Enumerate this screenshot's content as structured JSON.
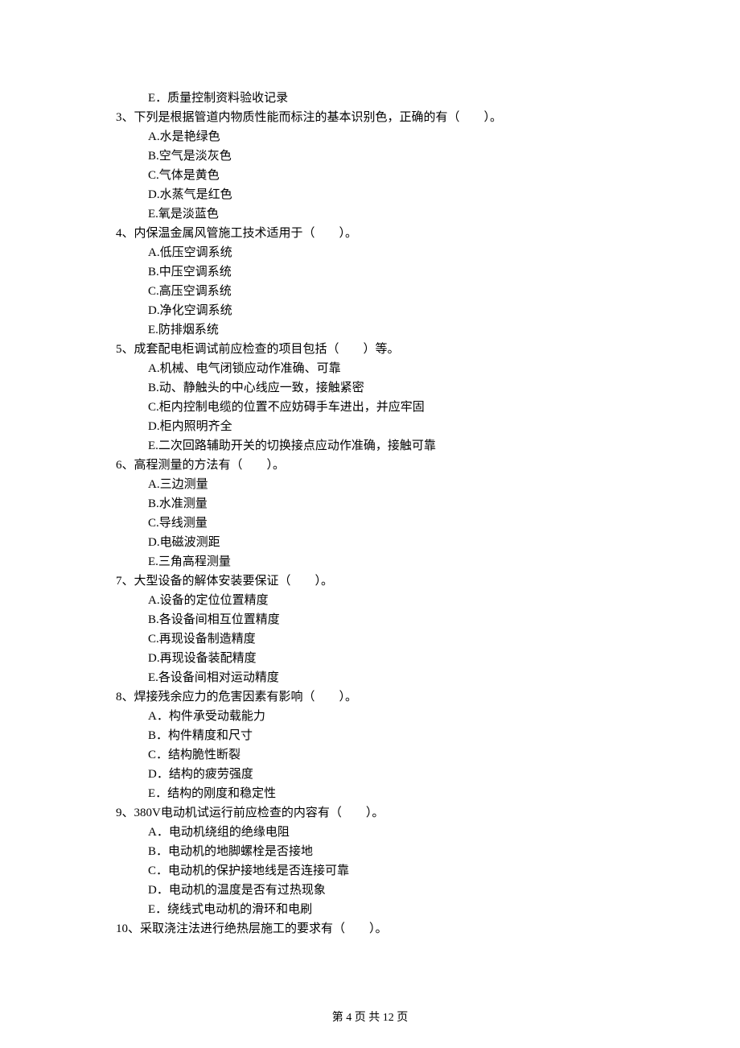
{
  "orphan_option_E": "E．质量控制资料验收记录",
  "questions": [
    {
      "stem": "3、下列是根据管道内物质性能而标注的基本识别色，正确的有（　　）。",
      "options": [
        "A.水是艳绿色",
        "B.空气是淡灰色",
        "C.气体是黄色",
        "D.水蒸气是红色",
        "E.氧是淡蓝色"
      ]
    },
    {
      "stem": "4、内保温金属风管施工技术适用于（　　）。",
      "options": [
        "A.低压空调系统",
        "B.中压空调系统",
        "C.高压空调系统",
        "D.净化空调系统",
        "E.防排烟系统"
      ]
    },
    {
      "stem": "5、成套配电柜调试前应检查的项目包括（　　）等。",
      "options": [
        "A.机械、电气闭锁应动作准确、可靠",
        "B.动、静触头的中心线应一致，接触紧密",
        "C.柜内控制电缆的位置不应妨碍手车进出，并应牢固",
        "D.柜内照明齐全",
        "E.二次回路辅助开关的切换接点应动作准确，接触可靠"
      ]
    },
    {
      "stem": "6、高程测量的方法有（　　）。",
      "options": [
        "A.三边测量",
        "B.水准测量",
        "C.导线测量",
        "D.电磁波测距",
        "E.三角高程测量"
      ]
    },
    {
      "stem": "7、大型设备的解体安装要保证（　　）。",
      "options": [
        "A.设备的定位位置精度",
        "B.各设备间相互位置精度",
        "C.再现设备制造精度",
        "D.再现设备装配精度",
        "E.各设备间相对运动精度"
      ]
    },
    {
      "stem": "8、焊接残余应力的危害因素有影响（　　）。",
      "options": [
        "A．构件承受动载能力",
        "B．构件精度和尺寸",
        "C．结构脆性断裂",
        "D．结构的疲劳强度",
        "E．结构的刚度和稳定性"
      ]
    },
    {
      "stem": "9、380V电动机试运行前应检查的内容有（　　）。",
      "options": [
        "A．电动机绕组的绝缘电阻",
        "B．电动机的地脚螺栓是否接地",
        "C．电动机的保护接地线是否连接可靠",
        "D．电动机的温度是否有过热现象",
        "E．绕线式电动机的滑环和电刷"
      ]
    },
    {
      "stem": "10、采取浇注法进行绝热层施工的要求有（　　）。",
      "options": []
    }
  ],
  "footer": "第 4 页 共 12 页"
}
